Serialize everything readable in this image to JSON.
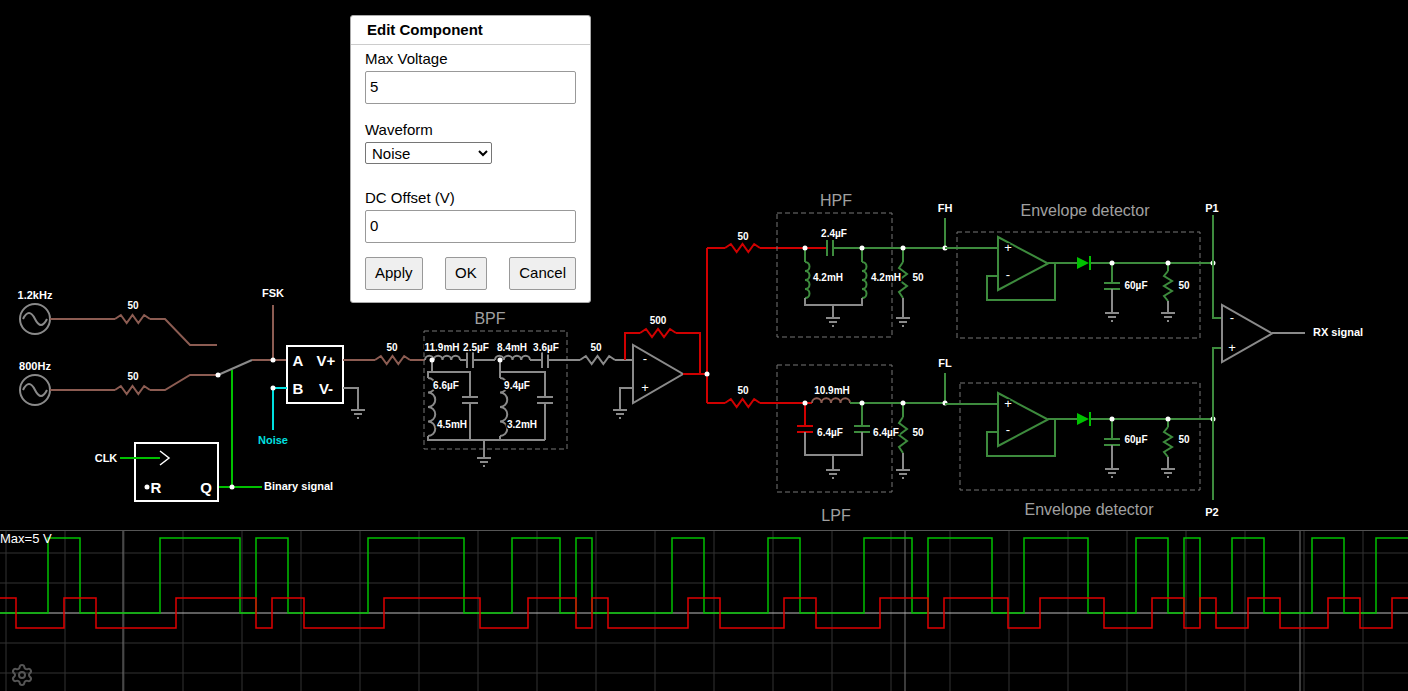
{
  "dialog": {
    "title": "Edit Component",
    "fields": [
      {
        "label": "Max Voltage",
        "kind": "input",
        "value": "5"
      },
      {
        "label": "Waveform",
        "kind": "select",
        "value": "Noise"
      },
      {
        "label": "DC Offset (V)",
        "kind": "input",
        "value": "0"
      }
    ],
    "buttons": [
      "Apply",
      "OK",
      "Cancel"
    ]
  },
  "circuit": {
    "labels": [
      {
        "text": "1.2kHz",
        "kind": "node"
      },
      {
        "text": "50",
        "kind": "value"
      },
      {
        "text": "800Hz",
        "kind": "node"
      },
      {
        "text": "50",
        "kind": "value"
      },
      {
        "text": "FSK",
        "kind": "node"
      },
      {
        "text": "A",
        "kind": "box"
      },
      {
        "text": "V+",
        "kind": "box"
      },
      {
        "text": "B",
        "kind": "box"
      },
      {
        "text": "V-",
        "kind": "box"
      },
      {
        "text": "Noise",
        "kind": "noise"
      },
      {
        "text": "CLK",
        "kind": "node"
      },
      {
        "text": "R",
        "kind": "box"
      },
      {
        "text": "Q",
        "kind": "box"
      },
      {
        "text": "Binary signal",
        "kind": "node"
      },
      {
        "text": "50",
        "kind": "value"
      },
      {
        "text": "BPF",
        "kind": "title"
      },
      {
        "text": "11.9mH",
        "kind": "value"
      },
      {
        "text": "2.5µF",
        "kind": "value"
      },
      {
        "text": "8.4mH",
        "kind": "value"
      },
      {
        "text": "3.6µF",
        "kind": "value"
      },
      {
        "text": "6.6µF",
        "kind": "value"
      },
      {
        "text": "9.4µF",
        "kind": "value"
      },
      {
        "text": "4.5mH",
        "kind": "value"
      },
      {
        "text": "3.2mH",
        "kind": "value"
      },
      {
        "text": "50",
        "kind": "value"
      },
      {
        "text": "500",
        "kind": "value"
      },
      {
        "text": "50",
        "kind": "value"
      },
      {
        "text": "HPF",
        "kind": "title"
      },
      {
        "text": "2.4µF",
        "kind": "value"
      },
      {
        "text": "4.2mH",
        "kind": "value"
      },
      {
        "text": "4.2mH",
        "kind": "value"
      },
      {
        "text": "50",
        "kind": "value"
      },
      {
        "text": "FH",
        "kind": "node"
      },
      {
        "text": "Envelope detector",
        "kind": "title"
      },
      {
        "text": "60µF",
        "kind": "value"
      },
      {
        "text": "50",
        "kind": "value"
      },
      {
        "text": "P1",
        "kind": "node"
      },
      {
        "text": "RX signal",
        "kind": "node"
      },
      {
        "text": "50",
        "kind": "value"
      },
      {
        "text": "10.9mH",
        "kind": "value"
      },
      {
        "text": "6.4µF",
        "kind": "value"
      },
      {
        "text": "6.4µF",
        "kind": "value"
      },
      {
        "text": "50",
        "kind": "value"
      },
      {
        "text": "FL",
        "kind": "node"
      },
      {
        "text": "60µF",
        "kind": "value"
      },
      {
        "text": "50",
        "kind": "value"
      },
      {
        "text": "Envelope detector",
        "kind": "title"
      },
      {
        "text": "P2",
        "kind": "node"
      },
      {
        "text": "LPF",
        "kind": "title"
      },
      {
        "text": "-",
        "kind": "sign"
      },
      {
        "text": "+",
        "kind": "sign"
      },
      {
        "text": "+",
        "kind": "sign"
      },
      {
        "text": "-",
        "kind": "sign"
      },
      {
        "text": "+",
        "kind": "sign"
      },
      {
        "text": "-",
        "kind": "sign"
      },
      {
        "text": "-",
        "kind": "sign"
      },
      {
        "text": "+",
        "kind": "sign"
      }
    ]
  },
  "scope": {
    "label": "Max=5 V",
    "series": [
      {
        "name": "Binary signal",
        "color": "#00c000",
        "values": [
          0,
          0,
          0,
          5,
          5,
          0,
          0,
          0,
          0,
          0,
          5,
          5,
          5,
          5,
          5,
          0,
          5,
          5,
          0,
          0,
          0,
          0,
          0,
          5,
          5,
          5,
          5,
          5,
          5,
          0,
          0,
          0,
          5,
          5,
          5,
          0,
          5,
          0,
          0,
          0,
          0,
          0,
          5,
          5,
          0,
          0,
          0,
          0,
          5,
          5,
          0,
          0,
          0,
          0,
          5,
          5,
          5,
          0,
          5,
          5,
          5,
          5,
          0,
          0,
          5,
          5,
          5,
          5,
          0,
          0,
          0,
          5,
          5,
          0,
          5,
          0,
          0,
          5,
          5,
          0,
          0,
          0,
          5,
          5,
          0,
          0,
          5,
          5
        ]
      },
      {
        "name": "RX signal",
        "color": "#e00000",
        "values": [
          1,
          -1,
          -1,
          -1,
          1,
          1,
          -1,
          -1,
          -1,
          -1,
          -1,
          1,
          1,
          1,
          1,
          1,
          -1,
          1,
          1,
          -1,
          -1,
          -1,
          -1,
          -1,
          1,
          1,
          1,
          1,
          1,
          1,
          -1,
          -1,
          -1,
          1,
          1,
          1,
          -1,
          1,
          -1,
          -1,
          -1,
          -1,
          -1,
          1,
          1,
          -1,
          -1,
          -1,
          -1,
          1,
          1,
          -1,
          -1,
          -1,
          -1,
          1,
          1,
          1,
          -1,
          1,
          1,
          1,
          1,
          -1,
          -1,
          1,
          1,
          1,
          1,
          -1,
          -1,
          -1,
          1,
          1,
          -1,
          1,
          -1,
          -1,
          1,
          1,
          -1,
          -1,
          -1,
          1,
          1,
          -1,
          -1,
          1
        ]
      }
    ]
  }
}
